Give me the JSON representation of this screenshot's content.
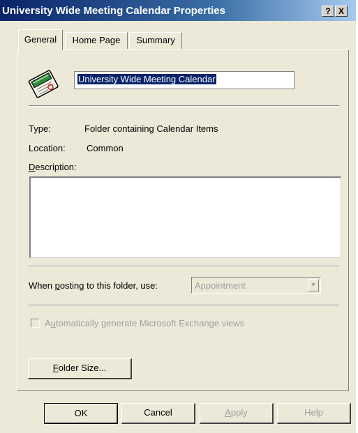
{
  "window": {
    "title": "University Wide Meeting Calendar Properties",
    "help_glyph": "?",
    "close_glyph": "X"
  },
  "tabs": [
    {
      "label": "General",
      "active": true
    },
    {
      "label": "Home Page",
      "active": false
    },
    {
      "label": "Summary",
      "active": false
    }
  ],
  "general": {
    "folder_icon": "calendar-folder-icon",
    "folder_name": "University Wide Meeting Calendar",
    "type_label": "Type:",
    "type_value": "Folder containing Calendar Items",
    "location_label": "Location:",
    "location_value": "Common",
    "description_label_prefix": "",
    "description_label_mnemonic": "D",
    "description_label_rest": "escription:",
    "description_value": "",
    "posting_label_prefix": "When ",
    "posting_label_mnemonic": "p",
    "posting_label_rest": "osting to this folder, use:",
    "posting_value": "Appointment",
    "auto_views_prefix": "A",
    "auto_views_mnemonic": "u",
    "auto_views_rest": "tomatically generate Microsoft Exchange views",
    "auto_views_checked": false,
    "folder_size_mnemonic": "F",
    "folder_size_rest": "older Size..."
  },
  "buttons": {
    "ok": "OK",
    "cancel": "Cancel",
    "apply_mnemonic": "A",
    "apply_rest": "pply",
    "help": "Help"
  },
  "colors": {
    "title_bar": "#0a246a",
    "selection": "#0a246a",
    "dialog_face": "#ece9d8",
    "disabled_text": "#a0a0a0"
  }
}
